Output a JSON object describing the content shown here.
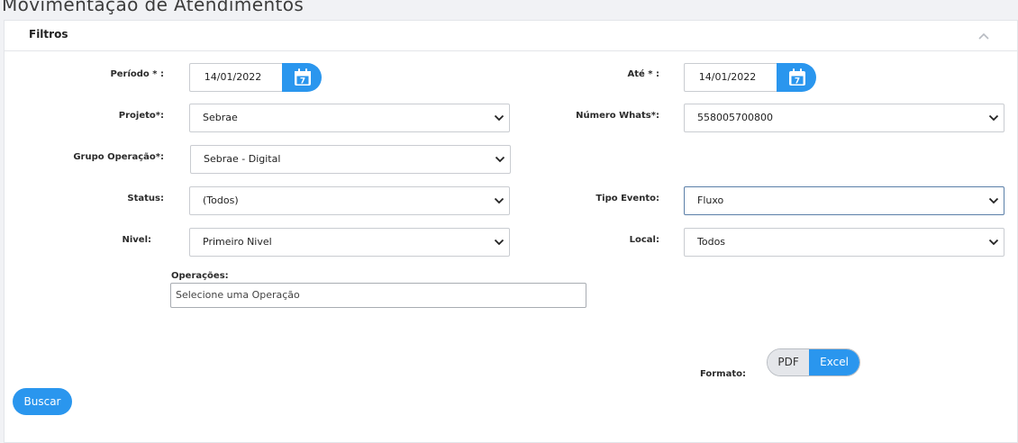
{
  "page": {
    "title": "Movimentação de Atendimentos"
  },
  "filters": {
    "title": "Filtros",
    "periodo": {
      "label": "Período * :",
      "value": "14/01/2022"
    },
    "ate": {
      "label": "Até * :",
      "value": "14/01/2022"
    },
    "projeto": {
      "label": "Projeto*:",
      "value": "Sebrae"
    },
    "numero_whats": {
      "label": "Número Whats*:",
      "value": "558005700800"
    },
    "grupo_operacao": {
      "label": "Grupo Operação*:",
      "value": "Sebrae - Digital"
    },
    "status": {
      "label": "Status:",
      "value": "(Todos)"
    },
    "tipo_evento": {
      "label": "Tipo Evento:",
      "value": "Fluxo"
    },
    "nivel": {
      "label": "Nivel:",
      "value": "Primeiro Nivel"
    },
    "local": {
      "label": "Local:",
      "value": "Todos"
    },
    "operacoes": {
      "label": "Operações:",
      "placeholder": "Selecione uma Operação"
    },
    "formato": {
      "label": "Formato:",
      "options": [
        "PDF",
        "Excel"
      ],
      "selected": "Excel"
    },
    "search_button": "Buscar"
  },
  "colors": {
    "accent": "#2a96ee",
    "background": "#f1f2f5"
  },
  "icons": {
    "calendar": "calendar-icon",
    "collapse": "chevron-up-icon",
    "dropdown": "chevron-down-icon"
  }
}
